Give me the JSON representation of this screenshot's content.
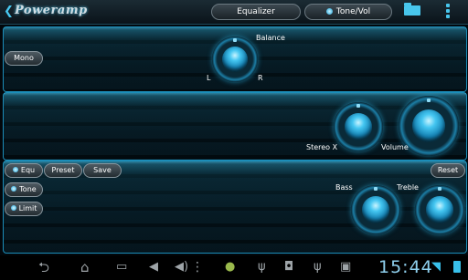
{
  "app": {
    "title": "Poweramp",
    "back_glyph": "❮"
  },
  "toolbar": {
    "equalizer_tab": "Equalizer",
    "tonevol_tab": "Tone/Vol",
    "folder_icon": "folder-icon",
    "menu_icon": "overflow-menu-icon"
  },
  "balance_panel": {
    "mono_label": "Mono",
    "balance_label": "Balance",
    "left_label": "L",
    "right_label": "R"
  },
  "volume_panel": {
    "stereo_label": "Stereo X",
    "volume_label": "Volume"
  },
  "eq_panel": {
    "equ_label": "Equ",
    "preset_label": "Preset",
    "save_label": "Save",
    "reset_label": "Reset",
    "tone_label": "Tone",
    "limit_label": "Limit",
    "bass_label": "Bass",
    "treble_label": "Treble"
  },
  "system_bar": {
    "clock": "15:44",
    "icons": [
      "back-icon",
      "home-icon",
      "recent-apps-icon",
      "volume-down-icon",
      "volume-up-icon",
      "overflow-icon",
      "android-icon",
      "usb-icon",
      "android-debug-icon",
      "usb-icon",
      "screenshot-icon",
      "wifi-icon",
      "battery-icon"
    ]
  },
  "colors": {
    "accent": "#1c9fd8",
    "panel_border": "#1c8db8",
    "background": "#02070b"
  }
}
